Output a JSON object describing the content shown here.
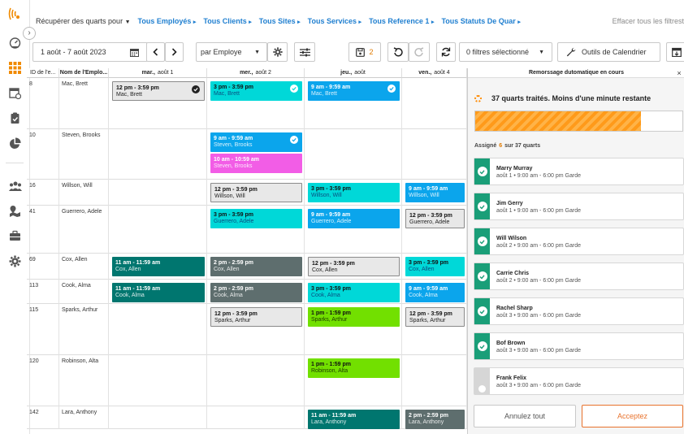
{
  "filters": {
    "label": "Récupérer des quarts pour",
    "links": [
      "Tous Employés",
      "Tous Clients",
      "Tous Sites",
      "Tous Services",
      "Tous Reference 1",
      "Tous Statuts De Quar"
    ],
    "clear": "Effacer tous les filtrest"
  },
  "toolbar": {
    "date_range": "1 août - 7 août 2023",
    "group_by": "par Employe",
    "save_count": "2",
    "filters_selected": "0 filtres sélectionné",
    "calendar_tools": "Outils de Calendrier"
  },
  "grid": {
    "col_id": "ID de l'e...",
    "col_name": "Nom de l'Emplo...",
    "days": [
      {
        "day": "mar.,",
        "date": "août 1"
      },
      {
        "day": "mer.,",
        "date": "août 2"
      },
      {
        "day": "jeu.,",
        "date": "août"
      },
      {
        "day": "ven.,",
        "date": "août 4"
      }
    ],
    "rows": [
      {
        "id": "8",
        "name": "Mac, Brett"
      },
      {
        "id": "10",
        "name": "Steven, Brooks"
      },
      {
        "id": "16",
        "name": "Willson, Will"
      },
      {
        "id": "41",
        "name": "Guerrero, Adele"
      },
      {
        "id": "69",
        "name": "Cox, Allen"
      },
      {
        "id": "113",
        "name": "Cook, Alma"
      },
      {
        "id": "115",
        "name": "Sparks, Arthur"
      },
      {
        "id": "120",
        "name": "Robinson, Alta"
      },
      {
        "id": "142",
        "name": "Lara, Anthony"
      }
    ],
    "shifts": [
      {
        "row": 0,
        "day": 0,
        "slot": 0,
        "time": "12 pm - 3:59 pm",
        "name": "Mac, Brett",
        "color": "gray",
        "check": true
      },
      {
        "row": 0,
        "day": 1,
        "slot": 0,
        "time": "3 pm - 3:59 pm",
        "name": "Mac, Brett",
        "color": "cyan",
        "check": true
      },
      {
        "row": 0,
        "day": 2,
        "slot": 0,
        "time": "9 am - 9:59 am",
        "name": "Mac, Brett",
        "color": "blue",
        "check": true
      },
      {
        "row": 1,
        "day": 1,
        "slot": 0,
        "time": "9 am - 9:59 am",
        "name": "Steven, Brooks",
        "color": "blue",
        "check": true
      },
      {
        "row": 1,
        "day": 1,
        "slot": 1,
        "time": "10 am - 10:59 am",
        "name": "Steven, Brooks",
        "color": "pink",
        "check": false
      },
      {
        "row": 2,
        "day": 1,
        "slot": 0,
        "time": "12 pm - 3:59 pm",
        "name": "Willson, Will",
        "color": "gray",
        "check": false
      },
      {
        "row": 2,
        "day": 2,
        "slot": 0,
        "time": "3 pm - 3:59 pm",
        "name": "Willson, Will",
        "color": "cyan",
        "check": false
      },
      {
        "row": 2,
        "day": 3,
        "slot": 0,
        "time": "9 am - 9:59 am",
        "name": "Willson, Will",
        "color": "blue",
        "check": false
      },
      {
        "row": 3,
        "day": 1,
        "slot": 0,
        "time": "3 pm - 3:59 pm",
        "name": "Guerrero, Adele",
        "color": "cyan",
        "check": false
      },
      {
        "row": 3,
        "day": 2,
        "slot": 0,
        "time": "9 am - 9:59 am",
        "name": "Guerrero, Adele",
        "color": "blue",
        "check": false
      },
      {
        "row": 3,
        "day": 3,
        "slot": 0,
        "time": "12 pm - 3:59 pm",
        "name": "Guerrero, Adele",
        "color": "gray",
        "check": false
      },
      {
        "row": 4,
        "day": 0,
        "slot": 0,
        "time": "11 am - 11:59 am",
        "name": "Cox, Allen",
        "color": "teal",
        "check": false
      },
      {
        "row": 4,
        "day": 1,
        "slot": 0,
        "time": "2 pm - 2:59 pm",
        "name": "Cox, Allen",
        "color": "dark",
        "check": false
      },
      {
        "row": 4,
        "day": 2,
        "slot": 0,
        "time": "12 pm - 3:59 pm",
        "name": "Cox, Allen",
        "color": "gray",
        "check": false
      },
      {
        "row": 4,
        "day": 3,
        "slot": 0,
        "time": "3 pm - 3:59 pm",
        "name": "Cox, Allen",
        "color": "cyan",
        "check": false
      },
      {
        "row": 5,
        "day": 0,
        "slot": 0,
        "time": "11 am - 11:59 am",
        "name": "Cook, Alma",
        "color": "teal",
        "check": false
      },
      {
        "row": 5,
        "day": 1,
        "slot": 0,
        "time": "2 pm - 2:59 pm",
        "name": "Cook, Alma",
        "color": "dark",
        "check": false
      },
      {
        "row": 5,
        "day": 2,
        "slot": 0,
        "time": "3 pm - 3:59 pm",
        "name": "Cook, Alma",
        "color": "cyan",
        "check": false
      },
      {
        "row": 5,
        "day": 3,
        "slot": 0,
        "time": "9 am - 9:59 am",
        "name": "Cook, Alma",
        "color": "blue",
        "check": false
      },
      {
        "row": 6,
        "day": 1,
        "slot": 0,
        "time": "12 pm - 3:59 pm",
        "name": "Sparks, Arthur",
        "color": "gray",
        "check": false
      },
      {
        "row": 6,
        "day": 2,
        "slot": 0,
        "time": "1 pm - 1:59 pm",
        "name": "Sparks, Arthur",
        "color": "green",
        "check": false
      },
      {
        "row": 6,
        "day": 3,
        "slot": 0,
        "time": "12 pm - 3:59 pm",
        "name": "Sparks, Arthur",
        "color": "gray",
        "check": false
      },
      {
        "row": 7,
        "day": 2,
        "slot": 0,
        "time": "1 pm - 1:59 pm",
        "name": "Robinson, Alta",
        "color": "green",
        "check": false
      },
      {
        "row": 8,
        "day": 2,
        "slot": 0,
        "time": "11 am - 11:59 am",
        "name": "Lara, Anthony",
        "color": "teal",
        "check": false
      },
      {
        "row": 8,
        "day": 3,
        "slot": 0,
        "time": "2 pm - 2:59 pm",
        "name": "Lara, Anthony",
        "color": "dark",
        "check": false
      }
    ]
  },
  "colors": {
    "gray": "#e8e8e8",
    "cyan": "#00d8d8",
    "blue": "#0ba5ec",
    "pink": "#f25de6",
    "teal": "#00766f",
    "dark": "#5e6e6e",
    "green": "#72e000",
    "accent": "#e8722c",
    "success": "#1a9e78",
    "link": "#1f7fd0"
  },
  "panel": {
    "title": "Remorssage dutomatique en cours",
    "status": "37 quarts traités. Moins d'une minute restante",
    "progress": 0.8,
    "assigned_label": "Assigné",
    "assigned_count": "6",
    "assigned_total": "sur 37 quarts",
    "items": [
      {
        "name": "Marry Murray",
        "detail": "août 1 • 9:00 am - 6:00 pm Garde",
        "status": "done"
      },
      {
        "name": "Jim Gerry",
        "detail": "août 1 • 9:00 am - 6:00 pm Garde",
        "status": "done"
      },
      {
        "name": "Will Wilson",
        "detail": "août 2 • 9:00 am - 6:00 pm Garde",
        "status": "done"
      },
      {
        "name": "Carrie Chris",
        "detail": "août 2 • 9:00 am - 6:00 pm Garde",
        "status": "done"
      },
      {
        "name": "Rachel Sharp",
        "detail": "août 3 • 9:00 am - 6:00 pm Garde",
        "status": "done"
      },
      {
        "name": "Bof Brown",
        "detail": "août 3 • 9:00 am - 6:00 pm Garde",
        "status": "done"
      },
      {
        "name": "Frank Felix",
        "detail": "août 3 • 9:00 am - 6:00 pm Garde",
        "status": "pending"
      }
    ],
    "cancel_label": "Annulez tout",
    "accept_label": "Acceptez"
  }
}
